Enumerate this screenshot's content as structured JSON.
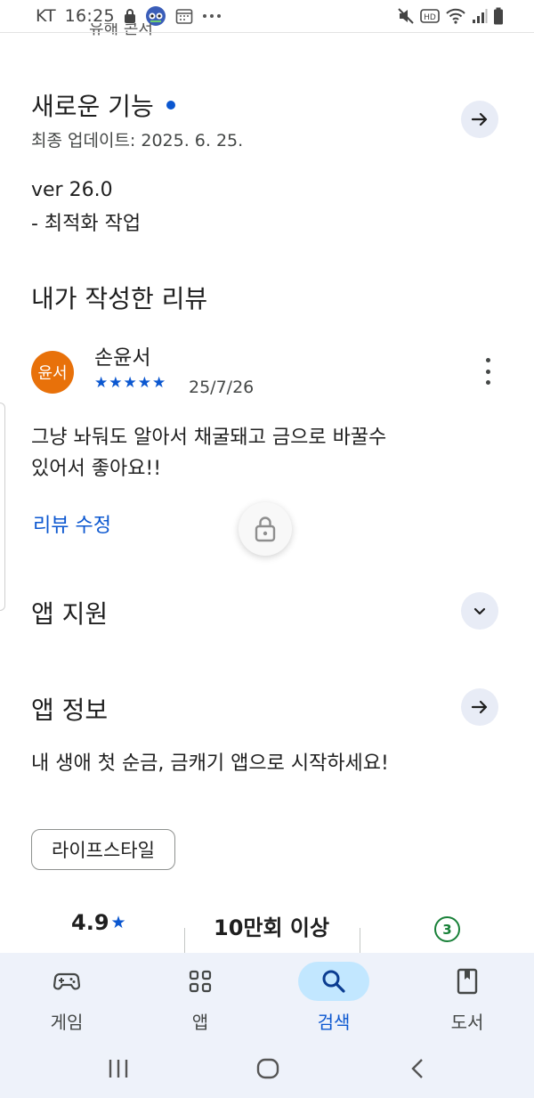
{
  "status_bar": {
    "carrier": "KT",
    "time": "16:25",
    "network_label": "HD"
  },
  "previous_section_cut": "유해 콘서",
  "whats_new": {
    "title": "새로운 기능",
    "updated": "최종 업데이트: 2025. 6. 25.",
    "version": "ver 26.0",
    "note": "- 최적화 작업"
  },
  "my_review": {
    "title": "내가 작성한 리뷰",
    "avatar_text": "윤서",
    "reviewer": "손윤서",
    "stars": "★★★★★",
    "rating": 5,
    "date": "25/7/26",
    "text_line1": "그냥 놔둬도 알아서 채굴돼고 금으로 바꿀수",
    "text_line2": "있어서 좋아요!!",
    "edit_label": "리뷰 수정"
  },
  "app_support": {
    "title": "앱 지원"
  },
  "app_info": {
    "title": "앱 정보",
    "description": "내 생애 첫 순금, 금캐기 앱으로 시작하세요!",
    "category_chip": "라이프스타일"
  },
  "stats": {
    "rating": "4.9",
    "rating_star": "★",
    "downloads": "10만회 이상",
    "age_badge": "3"
  },
  "bottom_nav": {
    "items": [
      {
        "label": "게임",
        "icon": "gamepad-icon"
      },
      {
        "label": "앱",
        "icon": "apps-grid-icon"
      },
      {
        "label": "검색",
        "icon": "search-icon"
      },
      {
        "label": "도서",
        "icon": "book-icon"
      }
    ],
    "active": "검색"
  },
  "colors": {
    "accent": "#0b57d0",
    "avatar": "#e8710a",
    "nav_bg": "#eef2fa",
    "active_pill": "#c2e7ff",
    "age_green": "#188038"
  }
}
